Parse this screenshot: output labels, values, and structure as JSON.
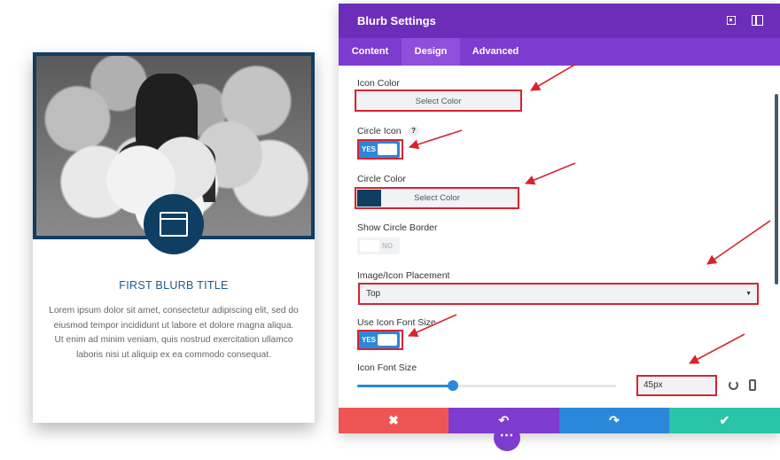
{
  "preview": {
    "blurb_title": "FIRST BLURB TITLE",
    "blurb_body": "Lorem ipsum dolor sit amet, consectetur adipiscing elit, sed do eiusmod tempor incididunt ut labore et dolore magna aliqua. Ut enim ad minim veniam, quis nostrud exercitation ullamco laboris nisi ut aliquip ex ea commodo consequat.",
    "icon_name": "window-icon",
    "accent_color": "#0f3e63"
  },
  "modal": {
    "title": "Blurb Settings",
    "header_color": "#6c2eb9",
    "tabs": [
      {
        "label": "Content",
        "active": false
      },
      {
        "label": "Design",
        "active": true
      },
      {
        "label": "Advanced",
        "active": false
      }
    ],
    "fields": {
      "icon_color": {
        "label": "Icon Color",
        "button": "Select Color"
      },
      "circle_icon": {
        "label": "Circle Icon",
        "help": "?",
        "toggle": "YES",
        "on": true
      },
      "circle_color": {
        "label": "Circle Color",
        "button": "Select Color",
        "swatch": "#0f3e63"
      },
      "show_circle_border": {
        "label": "Show Circle Border",
        "toggle": "NO",
        "on": false
      },
      "placement": {
        "label": "Image/Icon Placement",
        "value": "Top"
      },
      "use_icon_font_size": {
        "label": "Use Icon Font Size",
        "toggle": "YES",
        "on": true
      },
      "icon_font_size": {
        "label": "Icon Font Size",
        "value": "45px",
        "slider_fraction": 0.37
      }
    },
    "footer": {
      "cancel": "✖",
      "undo": "↶",
      "redo": "↷",
      "save": "✔",
      "colors": {
        "cancel": "#ef5555",
        "undo": "#7e3bd0",
        "redo": "#2b87da",
        "save": "#29c4a9"
      }
    },
    "more_button": "⋯"
  }
}
